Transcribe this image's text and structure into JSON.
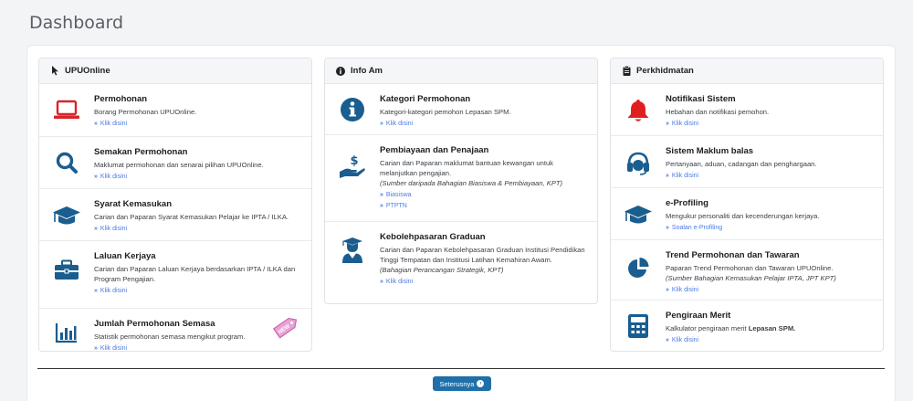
{
  "page_title": "Dashboard",
  "colors": {
    "accent": "#1a5d8f",
    "link": "#4d7be0",
    "alert": "#e02020",
    "button": "#1f6fa8"
  },
  "cards": [
    {
      "title": "UPUOnline",
      "icon": "cursor-pointer-icon",
      "items": [
        {
          "title": "Permohonan",
          "desc": "Borang Permohonan UPUOnline.",
          "link": "Klik disini",
          "icon": "laptop-icon"
        },
        {
          "title": "Semakan Permohonan",
          "desc": "Maklumat permohonan dan senarai pilihan UPUOnline.",
          "link": "Klik disini",
          "icon": "search-icon"
        },
        {
          "title": "Syarat Kemasukan",
          "desc": "Carian dan Paparan Syarat Kemasukan Pelajar ke IPTA / ILKA.",
          "link": "Klik disini",
          "icon": "graduation-cap-icon"
        },
        {
          "title": "Laluan Kerjaya",
          "desc": "Carian dan Paparan Laluan Kerjaya berdasarkan IPTA / ILKA dan Program Pengajian.",
          "link": "Klik disini",
          "icon": "briefcase-icon"
        },
        {
          "title": "Jumlah Permohonan Semasa",
          "desc": "Statistik permohonan semasa mengikut program.",
          "link": "Klik disini",
          "icon": "bar-chart-icon",
          "tag": "NEW"
        }
      ]
    },
    {
      "title": "Info Am",
      "icon": "info-circle-icon",
      "items": [
        {
          "title": "Kategori Permohonan",
          "desc": "Kategori-kategori pemohon Lepasan SPM.",
          "link": "Klik disini",
          "icon": "info-circle-icon"
        },
        {
          "title": "Pembiayaan dan Penajaan",
          "desc": "Carian dan Paparan maklumat bantuan kewangan untuk melanjutkan pengajian.",
          "desc_italic": "(Sumber daripada Bahagian Biasiswa & Pembiayaan, KPT)",
          "link": "Biasiswa",
          "link2": "PTPTN",
          "icon": "hand-dollar-icon"
        },
        {
          "title": "Kebolehpasaran Graduan",
          "desc": "Carian dan Paparan Kebolehpasaran Graduan Institusi Pendidikan Tinggi Tempatan dan Institusi Latihan Kemahiran Awam.",
          "desc_italic": "(Bahagian Perancangan Strategik, KPT)",
          "link": "Klik disini",
          "icon": "graduate-user-icon"
        }
      ]
    },
    {
      "title": "Perkhidmatan",
      "icon": "clipboard-icon",
      "items": [
        {
          "title": "Notifikasi Sistem",
          "desc": "Hebahan dan notifikasi pemohon.",
          "link": "Klik disini",
          "icon": "bell-icon"
        },
        {
          "title": "Sistem Maklum balas",
          "desc": "Pertanyaan, aduan, cadangan dan penghargaan.",
          "link": "Klik disini",
          "icon": "headset-icon"
        },
        {
          "title": "e-Profiling",
          "desc": "Mengukur personaliti dan kecenderungan kerjaya.",
          "link": "Soalan e-Profiling",
          "icon": "graduation-cap-icon"
        },
        {
          "title": "Trend Permohonan dan Tawaran",
          "desc": "Paparan Trend Permohonan dan Tawaran UPUOnline.",
          "desc_italic": "(Sumber Bahagian Kemasukan Pelajar IPTA, JPT KPT)",
          "link": "Klik disini",
          "icon": "pie-chart-icon"
        },
        {
          "title": "Pengiraan Merit",
          "desc_pre": "Kalkulator pengiraan merit ",
          "desc_bold": "Lepasan SPM.",
          "link": "Klik disini",
          "icon": "calculator-icon"
        }
      ]
    }
  ],
  "next_button": "Seterusnya"
}
